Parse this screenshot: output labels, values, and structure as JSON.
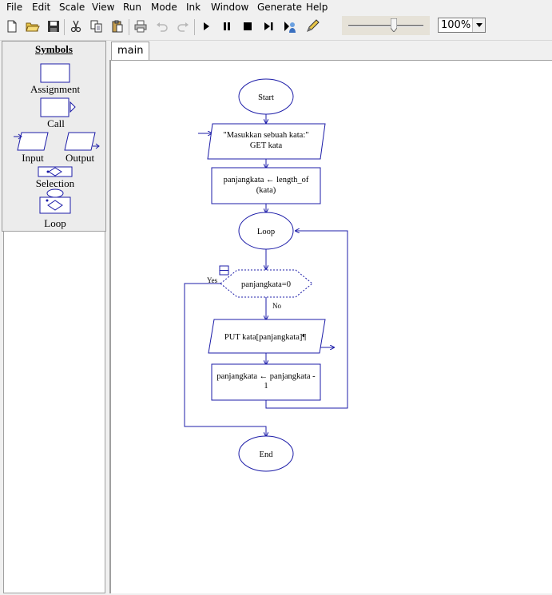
{
  "menu": [
    "File",
    "Edit",
    "Scale",
    "View",
    "Run",
    "Mode",
    "Ink",
    "Window",
    "Generate",
    "Help"
  ],
  "toolbar": {
    "zoom_value": "100%",
    "buttons": [
      "new-icon",
      "open-icon",
      "save-icon",
      "cut-icon",
      "copy-icon",
      "paste-icon",
      "print-icon",
      "undo-icon",
      "redo-icon",
      "play-icon",
      "pause-icon",
      "stop-icon",
      "step-icon",
      "tutorial-icon",
      "pen-icon"
    ]
  },
  "symbols": {
    "title": "Symbols",
    "assignment": "Assignment",
    "call": "Call",
    "input": "Input",
    "output": "Output",
    "selection": "Selection",
    "loop": "Loop"
  },
  "tabs": [
    "main"
  ],
  "flowchart": {
    "start": "Start",
    "input_line1": "\"Masukkan sebuah kata:\"",
    "input_line2": "GET kata",
    "assign1_line1": "panjangkata ← length_of",
    "assign1_line2": "(kata)",
    "loop": "Loop",
    "condition": "panjangkata=0",
    "yes": "Yes",
    "no": "No",
    "output": "PUT kata[panjangkata]¶",
    "assign2_line1": "panjangkata ← panjangkata -",
    "assign2_line2": "1",
    "end": "End"
  },
  "colors": {
    "flow_stroke": "#1c1ca8",
    "canvas_bg": "#ffffff",
    "chrome_bg": "#f0f0f0"
  }
}
